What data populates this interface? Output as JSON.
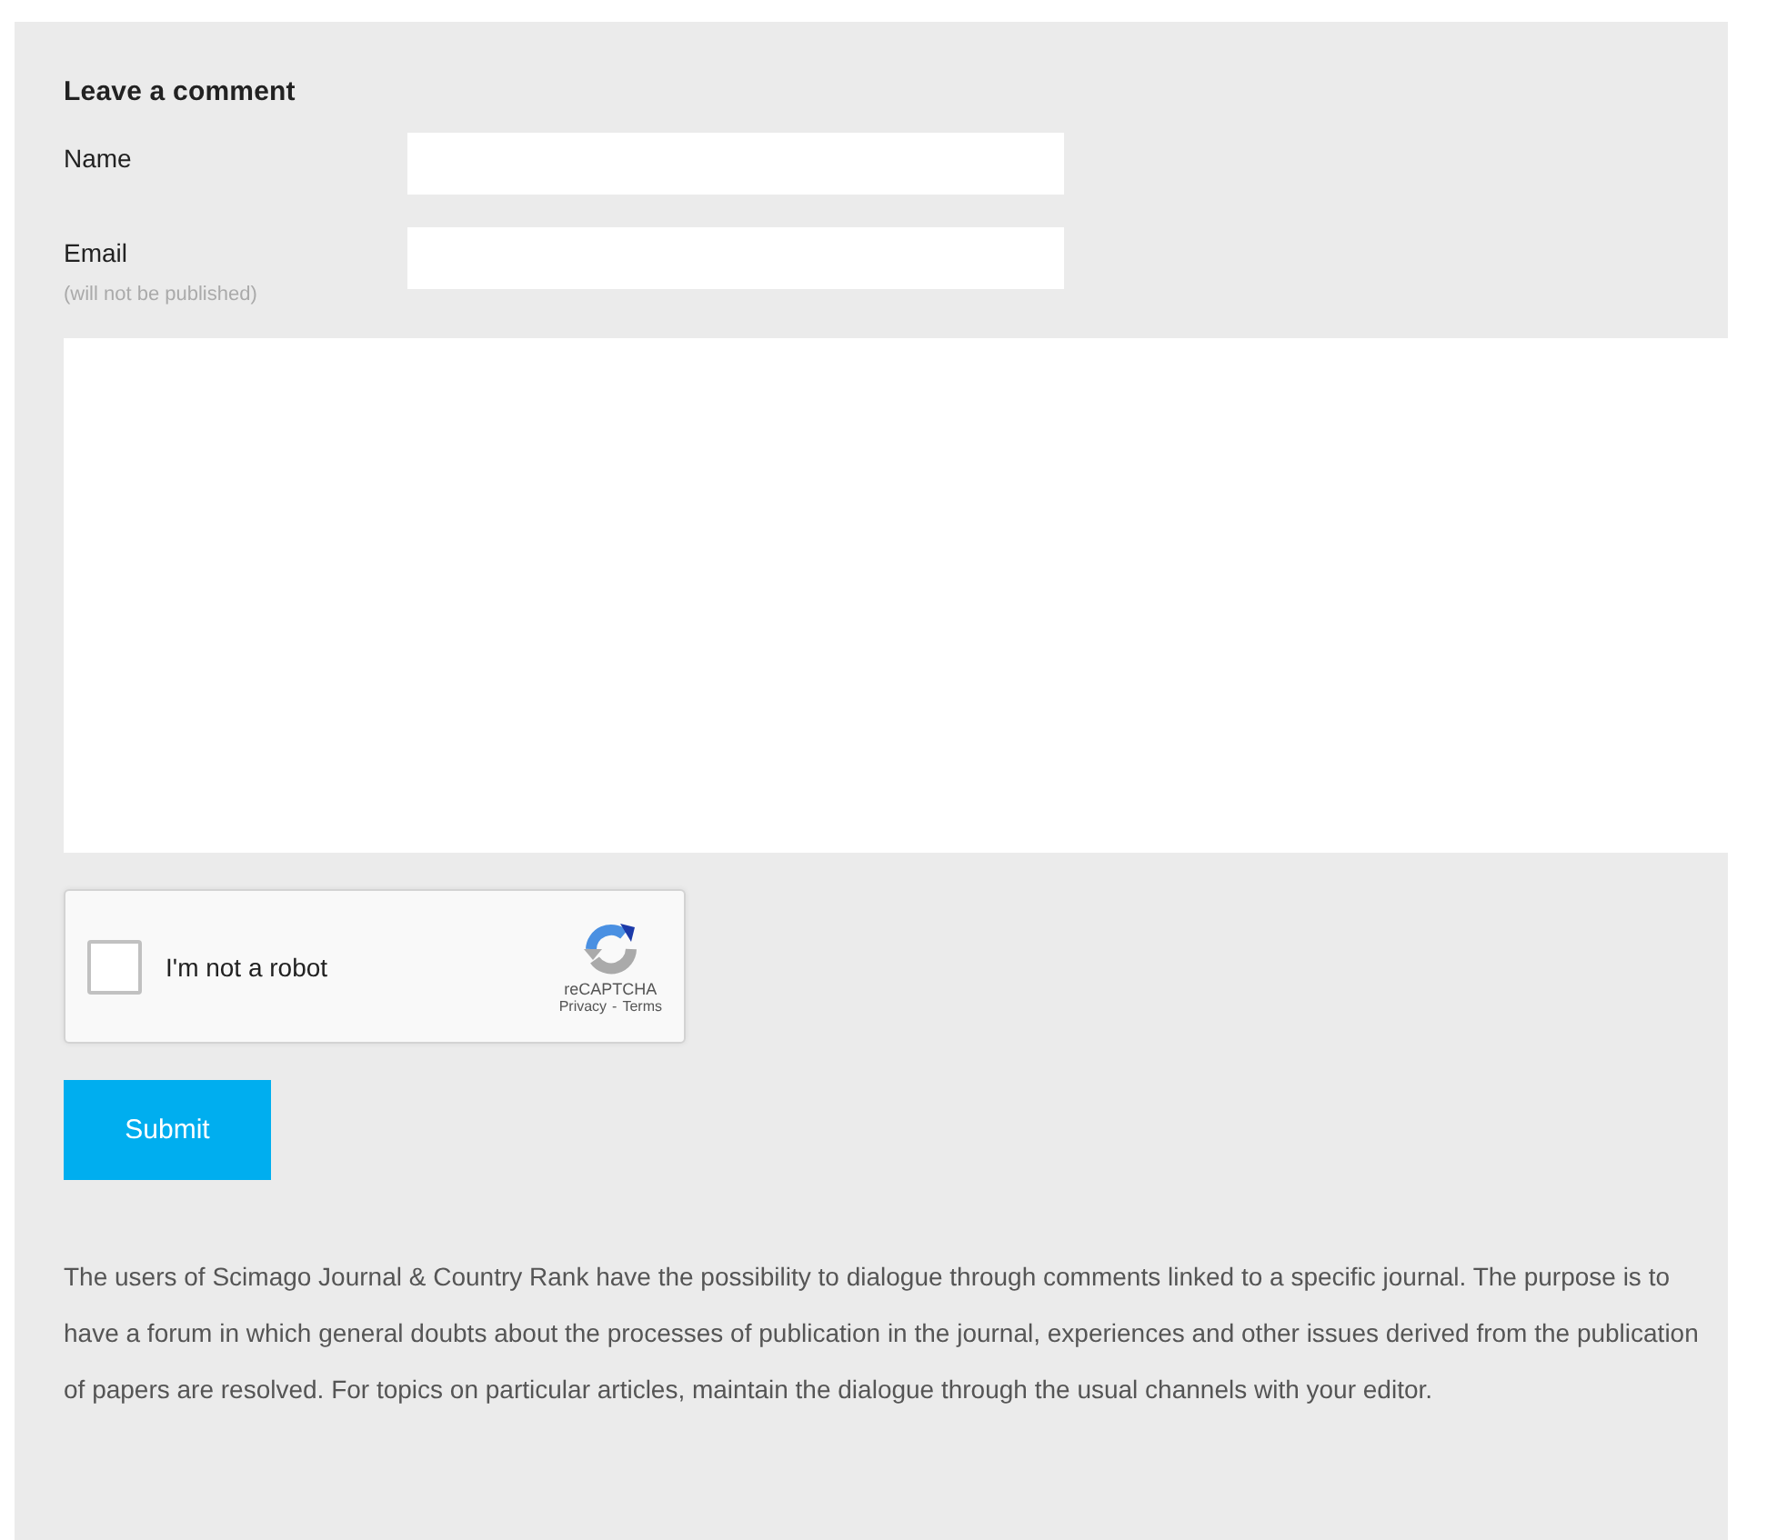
{
  "form": {
    "title": "Leave a comment",
    "fields": [
      {
        "label": "Name"
      },
      {
        "label": "Email",
        "hint": "(will not be published)"
      }
    ],
    "captcha": {
      "label": "I'm not a robot",
      "checked": false,
      "brand": "reCAPTCHA",
      "links": [
        "Privacy",
        "-",
        "Terms"
      ]
    },
    "submit": "Submit",
    "notice": "The users of Scimago Journal & Country Rank have the possibility to dialogue through comments linked to a specific journal. The purpose is to have a forum in which general doubts about the processes of publication in the journal, experiences and other issues derived from the publication of papers are resolved. For topics on particular articles, maintain the dialogue through the usual channels with your editor."
  }
}
